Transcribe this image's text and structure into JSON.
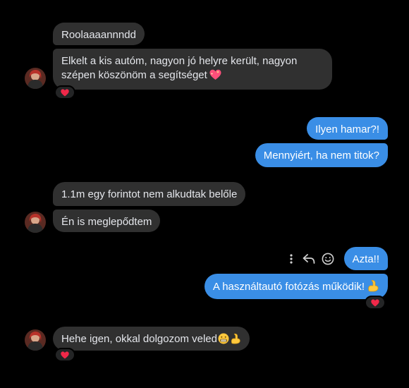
{
  "colors": {
    "background": "#000000",
    "incoming_bubble": "#303030",
    "outgoing_bubble": "#3a8ee6",
    "reaction_heart": "#f02849"
  },
  "messages": [
    {
      "direction": "in",
      "text": "Roolaaaannndd"
    },
    {
      "direction": "in",
      "text_line1": "Elkelt a kis autóm, nagyon jó helyre került, nagyon",
      "text_line2": "szépen köszönöm a segítséget",
      "emoji": "sparkling-heart-icon",
      "reaction": "heart-icon"
    },
    {
      "direction": "out",
      "text": "Ilyen hamar?!"
    },
    {
      "direction": "out",
      "text": "Mennyiért, ha nem titok?"
    },
    {
      "direction": "in",
      "text": "1.1m egy forintot nem alkudtak belőle"
    },
    {
      "direction": "in",
      "text": "Én is meglepődtem"
    },
    {
      "direction": "out",
      "text": "Azta!!"
    },
    {
      "direction": "out",
      "text": "A használtautó fotózás működik!",
      "emoji": "flexed-biceps-icon",
      "reaction": "heart-icon"
    },
    {
      "direction": "in",
      "text": "Hehe igen, okkal dolgozom veled",
      "emoji": "grimacing-face-and-biceps-icons",
      "reaction": "heart-icon"
    }
  ],
  "hover_actions": [
    "more-options-icon",
    "reply-icon",
    "react-smiley-icon"
  ]
}
